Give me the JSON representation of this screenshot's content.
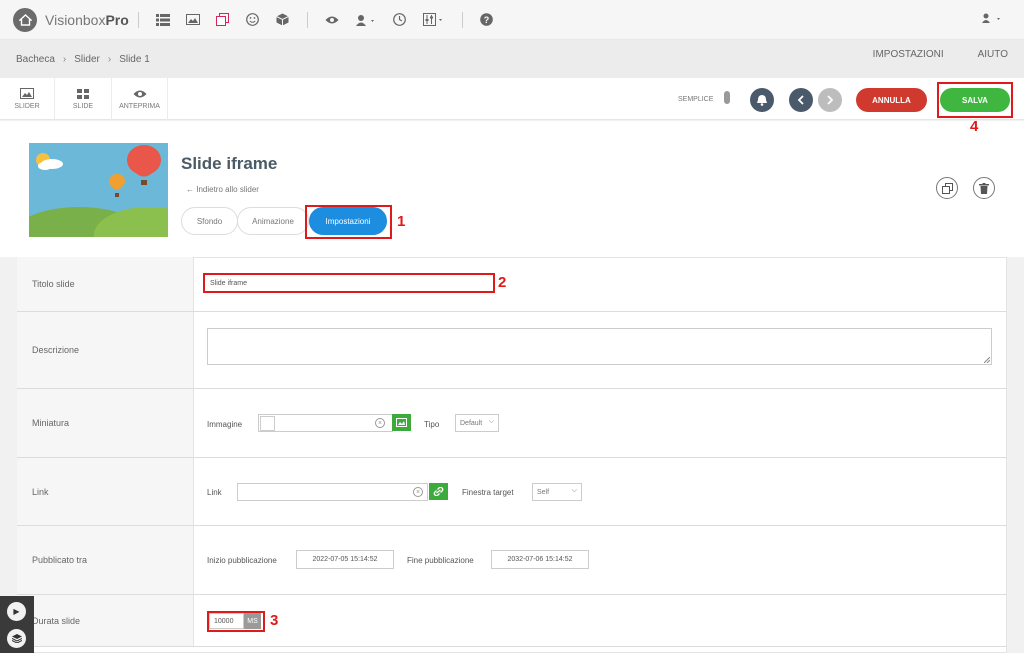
{
  "app": {
    "brand_prefix": "Visionbox",
    "brand_suffix": "Pro"
  },
  "top_icons": [
    "list-icon",
    "image-icon",
    "copy-icon",
    "smiley-icon",
    "cube-icon",
    "eye-icon",
    "user-icon",
    "clock-icon",
    "sliders-icon",
    "help-icon"
  ],
  "breadcrumb": [
    "Bacheca",
    "Slider",
    "Slide 1"
  ],
  "crumb_right": {
    "settings": "IMPOSTAZIONI",
    "help": "AIUTO"
  },
  "toolbar": {
    "tools": [
      {
        "label": "SLIDER"
      },
      {
        "label": "SLIDE"
      },
      {
        "label": "ANTEPRIMA"
      }
    ],
    "mode_label": "SEMPLICE",
    "cancel_label": "ANNULLA",
    "save_label": "SALVA"
  },
  "slide": {
    "title": "Slide iframe",
    "back_link": "Indietro allo slider",
    "tabs": [
      {
        "label": "Sfondo"
      },
      {
        "label": "Animazione"
      },
      {
        "label": "Impostazioni"
      }
    ],
    "active_tab": "Impostazioni"
  },
  "form": {
    "title_row": {
      "label": "Titolo slide",
      "value": "Slide iframe"
    },
    "description_row": {
      "label": "Descrizione",
      "value": ""
    },
    "thumbnail_row": {
      "label": "Miniatura",
      "image_label": "Immagine",
      "image_value": "",
      "type_label": "Tipo",
      "type_value": "Default"
    },
    "link_row": {
      "label": "Link",
      "link_label": "Link",
      "link_value": "",
      "target_label": "Finestra target",
      "target_value": "Self"
    },
    "publish_row": {
      "label": "Pubblicato tra",
      "start_label": "Inizio pubblicazione",
      "start_value": "2022-07-05 15:14:52",
      "end_label": "Fine pubblicazione",
      "end_value": "2032-07-06 15:14:52"
    },
    "duration_row": {
      "label": "Durata slide",
      "value": "10000",
      "unit": "MS"
    }
  },
  "annotations": [
    "1",
    "2",
    "3",
    "4"
  ],
  "colors": {
    "primary": "#1d8de0",
    "save": "#3fb63f",
    "cancel": "#d0392e",
    "annotation": "#e01a1a",
    "nav_dark": "#4a5a6a"
  }
}
